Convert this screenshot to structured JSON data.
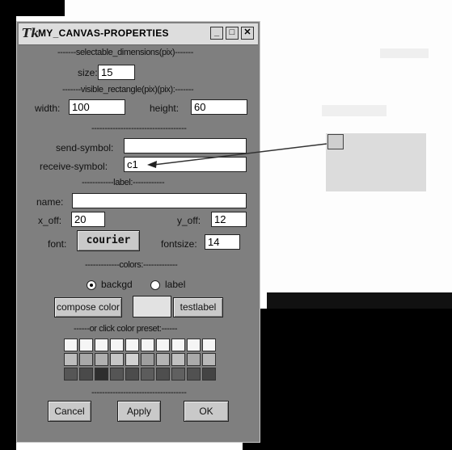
{
  "window": {
    "title": "MY_CANVAS-PROPERTIES",
    "title_icon": "Tk",
    "min_glyph": "_",
    "max_glyph": "□",
    "close_glyph": "✕"
  },
  "sections": {
    "selectable": "-------selectable_dimensions(pix)-------",
    "visible": "-------visible_rectangle(pix)(pix):-------",
    "divider": "------------------------------------",
    "label": "------------label:------------",
    "colors": "-------------colors:-------------",
    "preset": "------or click color preset:------",
    "bottom_divider": "------------------------------------"
  },
  "size": {
    "label": "size:",
    "value": "15"
  },
  "visible_rect": {
    "width_label": "width:",
    "width_value": "100",
    "height_label": "height:",
    "height_value": "60"
  },
  "send_symbol": {
    "label": "send-symbol:",
    "value": ""
  },
  "receive_symbol": {
    "label": "receive-symbol:",
    "value": "c1"
  },
  "label": {
    "name_label": "name:",
    "name_value": "",
    "x_off_label": "x_off:",
    "x_off_value": "20",
    "y_off_label": "y_off:",
    "y_off_value": "12",
    "font_label": "font:",
    "font_button": "courier",
    "fontsize_label": "fontsize:",
    "fontsize_value": "14"
  },
  "colors": {
    "backgd_label": "backgd",
    "label_label": "label",
    "compose_button": "compose color",
    "testlabel_button": "testlabel",
    "preset_rows": [
      [
        "#f5f5f5",
        "#f5f5f5",
        "#f5f5f5",
        "#f5f5f5",
        "#f5f5f5",
        "#f5f5f5",
        "#f5f5f5",
        "#f5f5f5",
        "#f5f5f5",
        "#f5f5f5"
      ],
      [
        "#bdbdbd",
        "#a8a8a8",
        "#b0b0b0",
        "#c6c6c6",
        "#d2d2d2",
        "#9e9e9e",
        "#b4b4b4",
        "#c0c0c0",
        "#aaaaaa",
        "#b8b8b8"
      ],
      [
        "#565656",
        "#4a4a4a",
        "#2e2e2e",
        "#555555",
        "#4c4c4c",
        "#5c5c5c",
        "#4e4e4e",
        "#606060",
        "#515151",
        "#444444"
      ]
    ]
  },
  "buttons": {
    "cancel": "Cancel",
    "apply": "Apply",
    "ok": "OK"
  }
}
